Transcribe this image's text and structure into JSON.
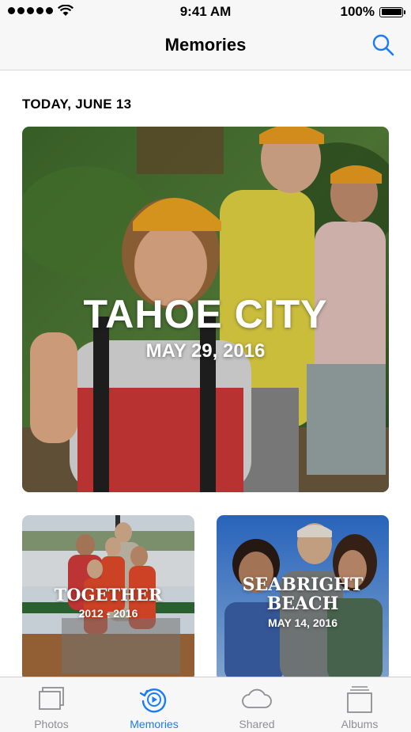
{
  "status_bar": {
    "time": "9:41 AM",
    "battery": "100%",
    "battery_level": 1.0
  },
  "nav": {
    "title": "Memories",
    "search_icon": "search-icon"
  },
  "section": {
    "header": "TODAY, JUNE 13"
  },
  "memories": [
    {
      "title": "TAHOE CITY",
      "date": "MAY 29, 2016"
    },
    {
      "title": "TOGETHER",
      "date": "2012 - 2016"
    },
    {
      "title": "SEABRIGHT BEACH",
      "date": "MAY 14, 2016"
    }
  ],
  "tabs": [
    {
      "label": "Photos",
      "icon": "photos-icon",
      "active": false
    },
    {
      "label": "Memories",
      "icon": "memories-icon",
      "active": true
    },
    {
      "label": "Shared",
      "icon": "cloud-icon",
      "active": false
    },
    {
      "label": "Albums",
      "icon": "albums-icon",
      "active": false
    }
  ],
  "colors": {
    "accent": "#1a7cf5",
    "inactive": "#8e8e93",
    "bar_background": "#f7f7f7"
  }
}
